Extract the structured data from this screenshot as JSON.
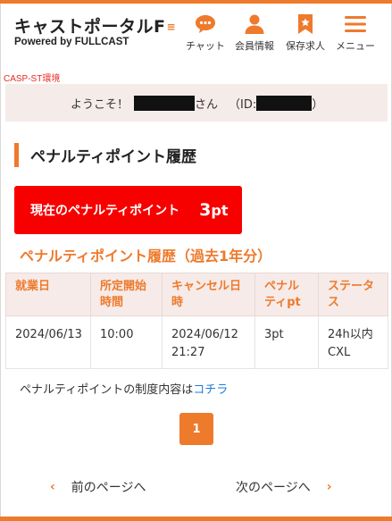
{
  "header": {
    "logo_title": "キャストポータルF",
    "logo_powered": "Powered by FULLCAST",
    "nav": [
      {
        "label": "チャット",
        "icon": "chat-icon"
      },
      {
        "label": "会員情報",
        "icon": "user-icon"
      },
      {
        "label": "保存求人",
        "icon": "bookmark-icon"
      },
      {
        "label": "メニュー",
        "icon": "hamburger-menu-icon"
      }
    ]
  },
  "env_label": "CASP-ST環境",
  "welcome": {
    "prefix": "ようこそ！",
    "suffix": "さん",
    "id_label": "（ID:",
    "id_close": "）"
  },
  "section_title": "ペナルティポイント履歴",
  "current_points": {
    "label": "現在のペナルティポイント",
    "value": "3",
    "unit": "pt"
  },
  "history_title": "ペナルティポイント履歴（過去1年分）",
  "table": {
    "headers": [
      "就業日",
      "所定開始時間",
      "キャンセル日時",
      "ペナルティpt",
      "ステータス"
    ],
    "rows": [
      {
        "work_date": "2024/06/13",
        "start_time": "10:00",
        "cancel_date": "2024/06/12",
        "cancel_time": "21:27",
        "penalty": "3pt",
        "status_line1": "24h以内",
        "status_line2": "CXL"
      }
    ]
  },
  "note": {
    "text": "ペナルティポイントの制度内容は",
    "link": "コチラ"
  },
  "pagination": {
    "current": "1",
    "prev": "前のページへ",
    "next": "次のページへ"
  },
  "colors": {
    "accent": "#ee7a2c",
    "alert": "#f70000",
    "link": "#1a7ad9",
    "env": "#e8281f"
  }
}
